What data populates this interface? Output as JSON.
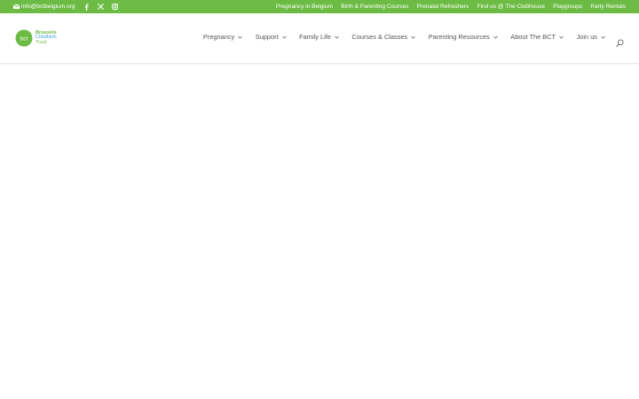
{
  "topbar": {
    "email": "info@bctbelgium.org",
    "icons": [
      "envelope-icon",
      "facebook-icon",
      "x-icon",
      "instagram-icon"
    ],
    "links": [
      "Pregnancy in Belgium",
      "Birth & Parenting Courses",
      "Prenatal Refreshers",
      "Find us @ The Clubhouse",
      "Playgroups",
      "Party Rentals"
    ],
    "background": "#6cbb45"
  },
  "logo": {
    "mark_text": "bct",
    "lines": [
      "Brussels",
      "Childbirth",
      "Trust"
    ]
  },
  "nav": {
    "items": [
      "Pregnancy",
      "Support",
      "Family Life",
      "Courses & Classes",
      "Parenting Resources",
      "About The BCT",
      "Join us"
    ],
    "search_icon": "search-icon"
  }
}
